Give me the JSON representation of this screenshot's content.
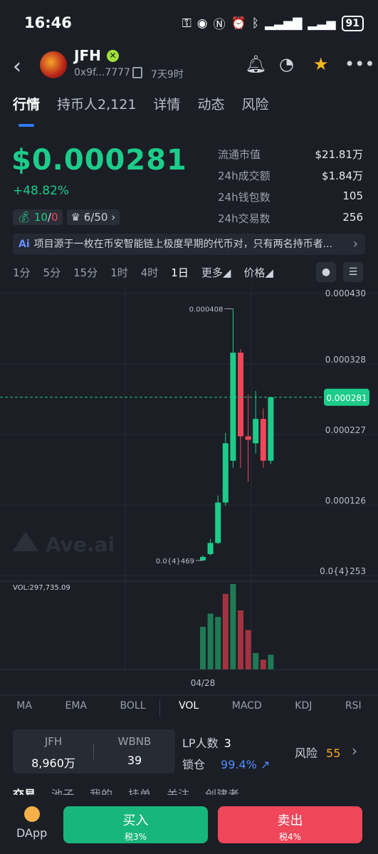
{
  "status": {
    "time": "16:46",
    "battery": "91"
  },
  "header": {
    "token_name": "JFH",
    "address": "0x9f...7777",
    "age": "7天9时"
  },
  "tabs": [
    "行情",
    "持币人2,121",
    "详情",
    "动态",
    "风险"
  ],
  "price": {
    "value": "$0.000281",
    "change": "+48.82%",
    "badge1_a": "10",
    "badge1_sep": "/",
    "badge1_b": "0",
    "badge2": "6/50"
  },
  "stats": [
    {
      "k": "流通市值",
      "v": "$21.81万"
    },
    {
      "k": "24h成交额",
      "v": "$1.84万"
    },
    {
      "k": "24h钱包数",
      "v": "105"
    },
    {
      "k": "24h交易数",
      "v": "256"
    }
  ],
  "ai_summary": "项目源于一枚在币安智能链上极度早期的代币对，只有两名持币者...",
  "timeframes": [
    "1分",
    "5分",
    "15分",
    "1时",
    "4时",
    "1日",
    "更多",
    "价格"
  ],
  "chart_data": {
    "type": "candlestick",
    "y_ticks": [
      "0.000430",
      "0.000328",
      "0.000227",
      "0.000126",
      "0.0{4}253"
    ],
    "ylim": [
      2.53e-05,
      0.00043
    ],
    "current_price_label": "0.000281",
    "current_price": 0.000281,
    "high_label": "0.000408",
    "low_label": "0.0{4}469",
    "watermark": "Ave.ai",
    "x_label": "04/28",
    "volume_label": "VOL:297,735.09",
    "candles": [
      {
        "o": 4.69e-05,
        "c": 5.2e-05,
        "h": 5.4e-05,
        "l": 4.69e-05,
        "up": true
      },
      {
        "o": 5.6e-05,
        "c": 7.2e-05,
        "h": 7.8e-05,
        "l": 5.4e-05,
        "up": true
      },
      {
        "o": 7.2e-05,
        "c": 0.00013,
        "h": 0.00014,
        "l": 7e-05,
        "up": true
      },
      {
        "o": 0.00013,
        "c": 0.000215,
        "h": 0.00023,
        "l": 0.000125,
        "up": true
      },
      {
        "o": 0.00019,
        "c": 0.000345,
        "h": 0.000408,
        "l": 0.00018,
        "up": true
      },
      {
        "o": 0.000345,
        "c": 0.000225,
        "h": 0.00035,
        "l": 0.00018,
        "up": false
      },
      {
        "o": 0.000225,
        "c": 0.00022,
        "h": 0.000285,
        "l": 0.00016,
        "up": false
      },
      {
        "o": 0.000215,
        "c": 0.00025,
        "h": 0.00029,
        "l": 0.0002,
        "up": true
      },
      {
        "o": 0.00025,
        "c": 0.00019,
        "h": 0.000265,
        "l": 0.00018,
        "up": false
      },
      {
        "o": 0.00019,
        "c": 0.000281,
        "h": 0.000281,
        "l": 0.000185,
        "up": true
      }
    ],
    "volumes": [
      {
        "v": 130,
        "up": true
      },
      {
        "v": 170,
        "up": true
      },
      {
        "v": 160,
        "up": true
      },
      {
        "v": 230,
        "up": false
      },
      {
        "v": 260,
        "up": true
      },
      {
        "v": 180,
        "up": false
      },
      {
        "v": 120,
        "up": false
      },
      {
        "v": 50,
        "up": true
      },
      {
        "v": 30,
        "up": false
      },
      {
        "v": 45,
        "up": true
      }
    ]
  },
  "indicators": [
    "MA",
    "EMA",
    "BOLL",
    "VOL",
    "MACD",
    "KDJ",
    "RSI"
  ],
  "pool": {
    "left_label": "JFH",
    "left_value": "8,960万",
    "right_label": "WBNB",
    "right_value": "39",
    "lp_label": "LP人数",
    "lp_value": "3",
    "lock_label": "锁仓",
    "lock_value": "99.4%",
    "risk_label": "风险",
    "risk_value": "55"
  },
  "bottom_tabs": [
    "交易",
    "池子",
    "我的",
    "挂单",
    "关注",
    "创建者"
  ],
  "footer": {
    "dapp": "DApp",
    "buy": "买入",
    "buy_tax": "税3%",
    "sell": "卖出",
    "sell_tax": "税4%"
  }
}
